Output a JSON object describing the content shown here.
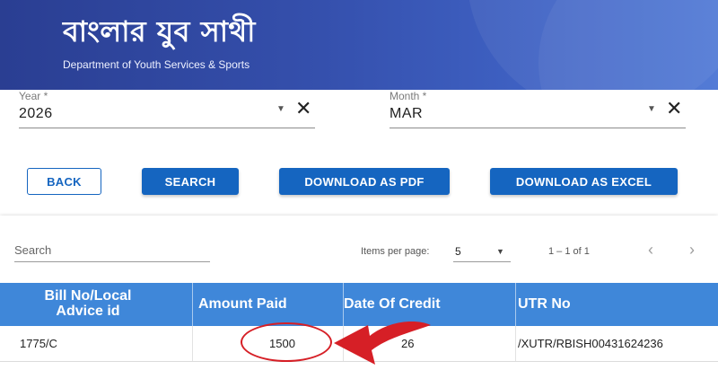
{
  "header": {
    "title": "বাংলার যুব সাথী",
    "subtitle": "Department of Youth Services & Sports"
  },
  "filters": {
    "year": {
      "label": "Year *",
      "value": "2026"
    },
    "month": {
      "label": "Month *",
      "value": "MAR"
    }
  },
  "actions": {
    "back": "BACK",
    "search": "SEARCH",
    "download_pdf": "DOWNLOAD AS PDF",
    "download_excel": "DOWNLOAD AS EXCEL"
  },
  "table_controls": {
    "search_placeholder": "Search",
    "items_per_page_label": "Items per page:",
    "items_per_page_value": "5",
    "range_label": "1 – 1 of 1"
  },
  "table": {
    "columns": [
      "Bill No/Local Advice id",
      "Amount Paid",
      "Date Of Credit",
      "UTR No"
    ],
    "rows": [
      {
        "bill_no": "1775/C",
        "amount_paid": "1500",
        "date_of_credit": "26",
        "utr_no": "/XUTR/RBISH00431624236"
      }
    ]
  },
  "colors": {
    "header_gradient_start": "#2a3e92",
    "primary": "#1565c0",
    "table_header": "#3f87d9",
    "annotation_red": "#d61f26"
  },
  "icons": [
    "close-icon",
    "dropdown-caret-icon",
    "chevron-left-icon",
    "chevron-right-icon",
    "arrow-annotation-icon"
  ]
}
